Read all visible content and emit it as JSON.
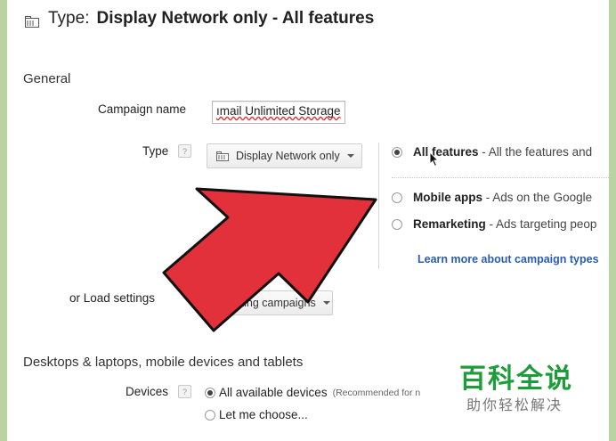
{
  "header": {
    "prefix": "Type:",
    "title": "Display Network only - All features"
  },
  "general": {
    "section_label": "General",
    "campaign_name_label": "Campaign name",
    "campaign_name_value": "ımail Unlimited Storage",
    "type_label": "Type",
    "help_glyph": "?",
    "type_dropdown": "Display Network only"
  },
  "type_options": [
    {
      "name": "All features",
      "desc": " - All the features and",
      "selected": true
    },
    {
      "name": "Mobile apps",
      "desc": " - Ads on the Google",
      "selected": false
    },
    {
      "name": "Remarketing",
      "desc": " - Ads targeting peop",
      "selected": false
    }
  ],
  "learn_more": "Learn more about campaign types",
  "load_settings": {
    "label": "or Load settings",
    "dropdown": "Existing campaigns"
  },
  "devices_section": {
    "title": "Desktops & laptops, mobile devices and tablets",
    "label": "Devices",
    "option_all": "All available devices",
    "option_all_note": "(Recommended for n",
    "option_choose": "Let me choose..."
  },
  "watermark": {
    "line1": "百科全说",
    "line2": "助你轻松解决"
  },
  "colors": {
    "arrow": "#e2313a",
    "arrow_outline": "#111111",
    "link": "#2a5db0",
    "frame": "#b9d3a3",
    "watermark": "#1d9c3a"
  }
}
